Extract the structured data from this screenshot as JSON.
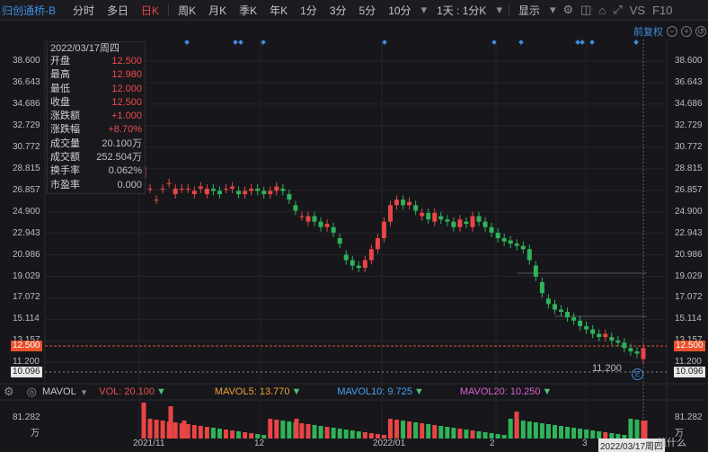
{
  "toolbar": {
    "stock_name": "归创通桥-B",
    "periods": [
      "分时",
      "多日",
      "日K",
      "周K",
      "月K",
      "季K",
      "年K",
      "1分",
      "3分",
      "5分",
      "10分"
    ],
    "active_period": "日K",
    "interval_select": "1天 : 1分K",
    "display_label": "显示",
    "vs_label": "VS",
    "f10_label": "F10"
  },
  "chart_header": {
    "fuquan": "前复权"
  },
  "info": {
    "date": "2022/03/17周四",
    "rows": [
      {
        "label": "开盘",
        "value": "12.500",
        "red": true
      },
      {
        "label": "最高",
        "value": "12.980",
        "red": true
      },
      {
        "label": "最低",
        "value": "12.000",
        "red": true
      },
      {
        "label": "收盘",
        "value": "12.500",
        "red": true
      },
      {
        "label": "涨跌额",
        "value": "+1.000",
        "red": true
      },
      {
        "label": "涨跌幅",
        "value": "+8.70%",
        "red": true
      },
      {
        "label": "成交量",
        "value": "20.100万",
        "red": false
      },
      {
        "label": "成交额",
        "value": "252.504万",
        "red": false
      },
      {
        "label": "换手率",
        "value": "0.062%",
        "red": false
      },
      {
        "label": "市盈率",
        "value": "0.000",
        "red": false
      }
    ]
  },
  "price_axis": {
    "ticks": [
      "38.600",
      "36.643",
      "34.686",
      "32.729",
      "30.772",
      "28.815",
      "26.857",
      "24.900",
      "22.943",
      "20.986",
      "19.029",
      "17.072",
      "15.114",
      "13.157",
      "11.200"
    ],
    "current": "12.500",
    "low": "10.096",
    "low_marker": "11.200"
  },
  "volume": {
    "label": "MAVOL",
    "vol": "VOL: 20.100",
    "mavol5": "MAVOL5: 13.770",
    "mavol10": "MAVOL10: 9.725",
    "mavol20": "MAVOL20: 10.250",
    "axis_top": "81.282",
    "unit": "万",
    "colors": {
      "vol": "#e85050",
      "mavol5": "#f0a030",
      "mavol10": "#4aa0f0",
      "mavol20": "#d860d0"
    }
  },
  "x_axis": {
    "labels": [
      "2021/11",
      "12",
      "2022/01",
      "2",
      "3"
    ],
    "cursor": "2022/03/17周四"
  },
  "badge": "E",
  "watermark": "值什么"
}
